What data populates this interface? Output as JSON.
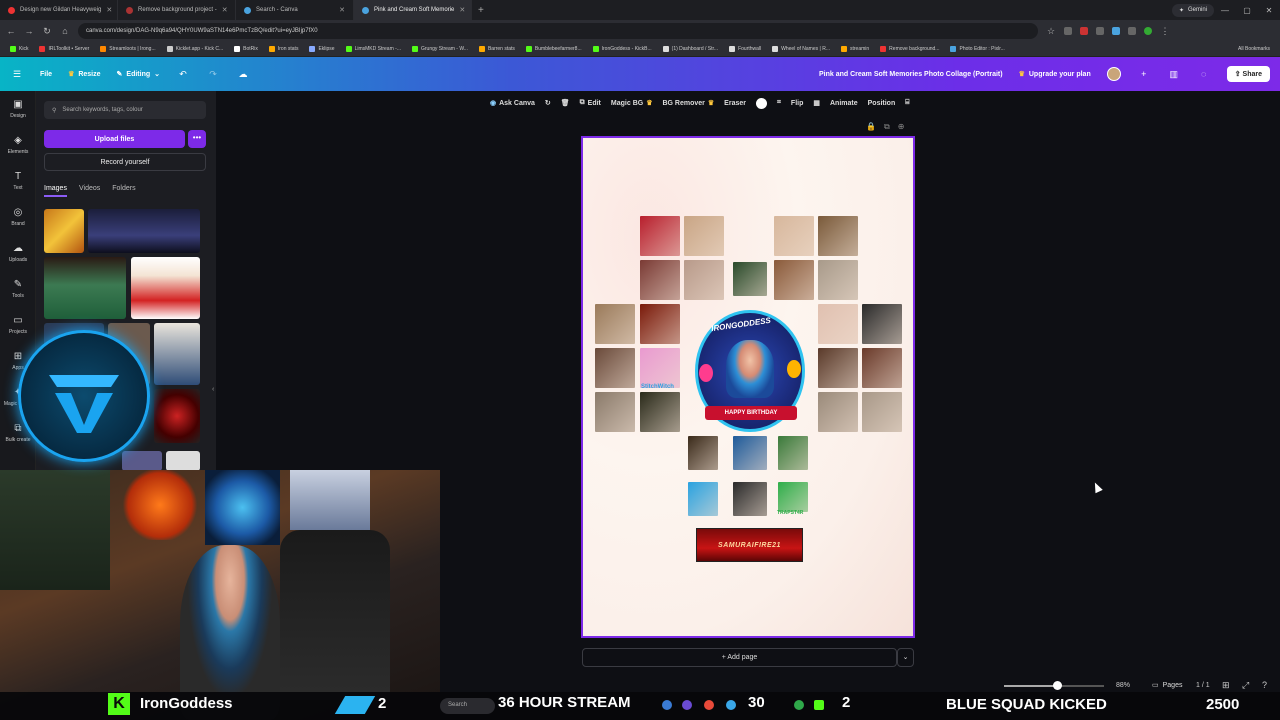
{
  "browser": {
    "tabs": [
      {
        "title": "Design new Gildan Heavyweig",
        "color": "#e33"
      },
      {
        "title": "Remove background project -",
        "color": "#a33"
      },
      {
        "title": "Search - Canva",
        "color": "#4aa3df"
      },
      {
        "title": "Pink and Cream Soft Memorie",
        "color": "#4aa3df",
        "active": true
      }
    ],
    "gemini_label": "Gemini",
    "url": "canva.com/design/DAG-N9q6a94/QHY0UW9aSTN14e6PmcTzBQ/edit?ui=eyJBIjp7fX0",
    "bookmarks": [
      {
        "label": "Kick",
        "color": "#53fc18"
      },
      {
        "label": "IRLToolkit • Server",
        "color": "#e33"
      },
      {
        "label": "Streamloots | Irong...",
        "color": "#f80"
      },
      {
        "label": "Kicklet.app - Kick C...",
        "color": "#ccc"
      },
      {
        "label": "BotRix",
        "color": "#fff"
      },
      {
        "label": "Iron stats",
        "color": "#fa0"
      },
      {
        "label": "Eklipse",
        "color": "#8af"
      },
      {
        "label": "LimsMKD Stream -...",
        "color": "#53fc18"
      },
      {
        "label": "Grungy Stream - W...",
        "color": "#53fc18"
      },
      {
        "label": "Barren stats",
        "color": "#fa0"
      },
      {
        "label": "Bumblebeefarmer8...",
        "color": "#53fc18"
      },
      {
        "label": "IronGoddess - KickB...",
        "color": "#53fc18"
      },
      {
        "label": "(1) Dashboard / Str...",
        "color": "#ddd"
      },
      {
        "label": "Fourthwall",
        "color": "#ddd"
      },
      {
        "label": "Wheel of Names | R...",
        "color": "#ddd"
      },
      {
        "label": "streamin",
        "color": "#fa0"
      },
      {
        "label": "Remove background...",
        "color": "#e33"
      },
      {
        "label": "Photo Editor : Pixlr...",
        "color": "#4aa3df"
      }
    ],
    "all_bookmarks": "All Bookmarks"
  },
  "header": {
    "file": "File",
    "resize": "Resize",
    "editing": "Editing",
    "doc_title": "Pink and Cream Soft Memories Photo Collage (Portrait)",
    "upgrade": "Upgrade your plan",
    "share": "Share"
  },
  "rail": [
    {
      "label": "Design",
      "icon": "layout-icon",
      "glyph": "▣"
    },
    {
      "label": "Elements",
      "icon": "elements-icon",
      "glyph": "◈"
    },
    {
      "label": "Text",
      "icon": "text-icon",
      "glyph": "T"
    },
    {
      "label": "Brand",
      "icon": "brand-icon",
      "glyph": "◎"
    },
    {
      "label": "Uploads",
      "icon": "uploads-icon",
      "glyph": "☁"
    },
    {
      "label": "Tools",
      "icon": "tools-icon",
      "glyph": "✎"
    },
    {
      "label": "Projects",
      "icon": "folder-icon",
      "glyph": "▭"
    },
    {
      "label": "Apps",
      "icon": "apps-icon",
      "glyph": "⊞"
    },
    {
      "label": "Magic Media",
      "icon": "magic-icon",
      "glyph": "✦"
    },
    {
      "label": "Bulk create",
      "icon": "bulk-icon",
      "glyph": "⧉"
    }
  ],
  "panel": {
    "search_placeholder": "Search keywords, tags, colour",
    "upload_label": "Upload files",
    "upload_more": "•••",
    "record_label": "Record yourself",
    "tabs": [
      "Images",
      "Videos",
      "Folders"
    ]
  },
  "toolbar": {
    "ask": "Ask Canva",
    "edit": "Edit",
    "magic_bg": "Magic BG",
    "bg_remover": "BG Remover",
    "eraser": "Eraser",
    "flip": "Flip",
    "animate": "Animate",
    "position": "Position"
  },
  "canvas": {
    "birthday_title": "IRONGODDESS",
    "birthday_ribbon": "HAPPY BIRTHDAY",
    "stitch_label": "StitchWitch",
    "trap_label": "TRAPST4R",
    "banner_text": "SAMURAIFIRE21",
    "add_page": "+ Add page"
  },
  "footer": {
    "zoom": "88%",
    "zoom_level": 0.53,
    "pages_label": "Pages",
    "page_count": "1 / 1"
  },
  "stream": {
    "streamer": "IronGoddess",
    "kick_badge": "K",
    "sub_count": "2",
    "search": "Search",
    "hours": "36 HOUR STREAM",
    "count_30": "30",
    "count_2": "2",
    "squad": "BLUE SQUAD KICKED",
    "points": "2500"
  }
}
